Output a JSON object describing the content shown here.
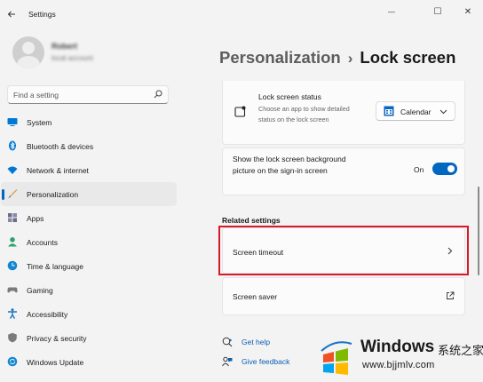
{
  "window": {
    "title": "Settings",
    "controls": {
      "minimize": "—",
      "maximize": "☐",
      "close": "✕"
    }
  },
  "profile": {
    "name": "Robert",
    "email": "local account"
  },
  "search": {
    "placeholder": "Find a setting"
  },
  "sidebar": {
    "items": [
      {
        "label": "System",
        "icon": "system-icon",
        "active": false
      },
      {
        "label": "Bluetooth & devices",
        "icon": "bluetooth-icon",
        "active": false
      },
      {
        "label": "Network & internet",
        "icon": "wifi-icon",
        "active": false
      },
      {
        "label": "Personalization",
        "icon": "brush-icon",
        "active": true
      },
      {
        "label": "Apps",
        "icon": "apps-icon",
        "active": false
      },
      {
        "label": "Accounts",
        "icon": "accounts-icon",
        "active": false
      },
      {
        "label": "Time & language",
        "icon": "globe-clock-icon",
        "active": false
      },
      {
        "label": "Gaming",
        "icon": "gaming-icon",
        "active": false
      },
      {
        "label": "Accessibility",
        "icon": "accessibility-icon",
        "active": false
      },
      {
        "label": "Privacy & security",
        "icon": "shield-icon",
        "active": false
      },
      {
        "label": "Windows Update",
        "icon": "update-icon",
        "active": false
      }
    ]
  },
  "breadcrumb": {
    "parent": "Personalization",
    "separator": "›",
    "current": "Lock screen"
  },
  "lock_status": {
    "title": "Lock screen status",
    "description": "Choose an app to show detailed status on the lock screen",
    "selected_app": "Calendar"
  },
  "bg_picture": {
    "label": "Show the lock screen background picture on the sign-in screen",
    "toggle_label": "On",
    "toggle_on": true
  },
  "related": {
    "heading": "Related settings",
    "screen_timeout": "Screen timeout",
    "screen_saver": "Screen saver"
  },
  "help": {
    "get_help": "Get help",
    "give_feedback": "Give feedback"
  },
  "watermark": {
    "brand": "Windows",
    "chinese": "系统之家",
    "url": "www.bjjmlv.com"
  },
  "colors": {
    "accent": "#0067c0",
    "highlight_border": "#d7192b",
    "link": "#0a5fb4"
  }
}
